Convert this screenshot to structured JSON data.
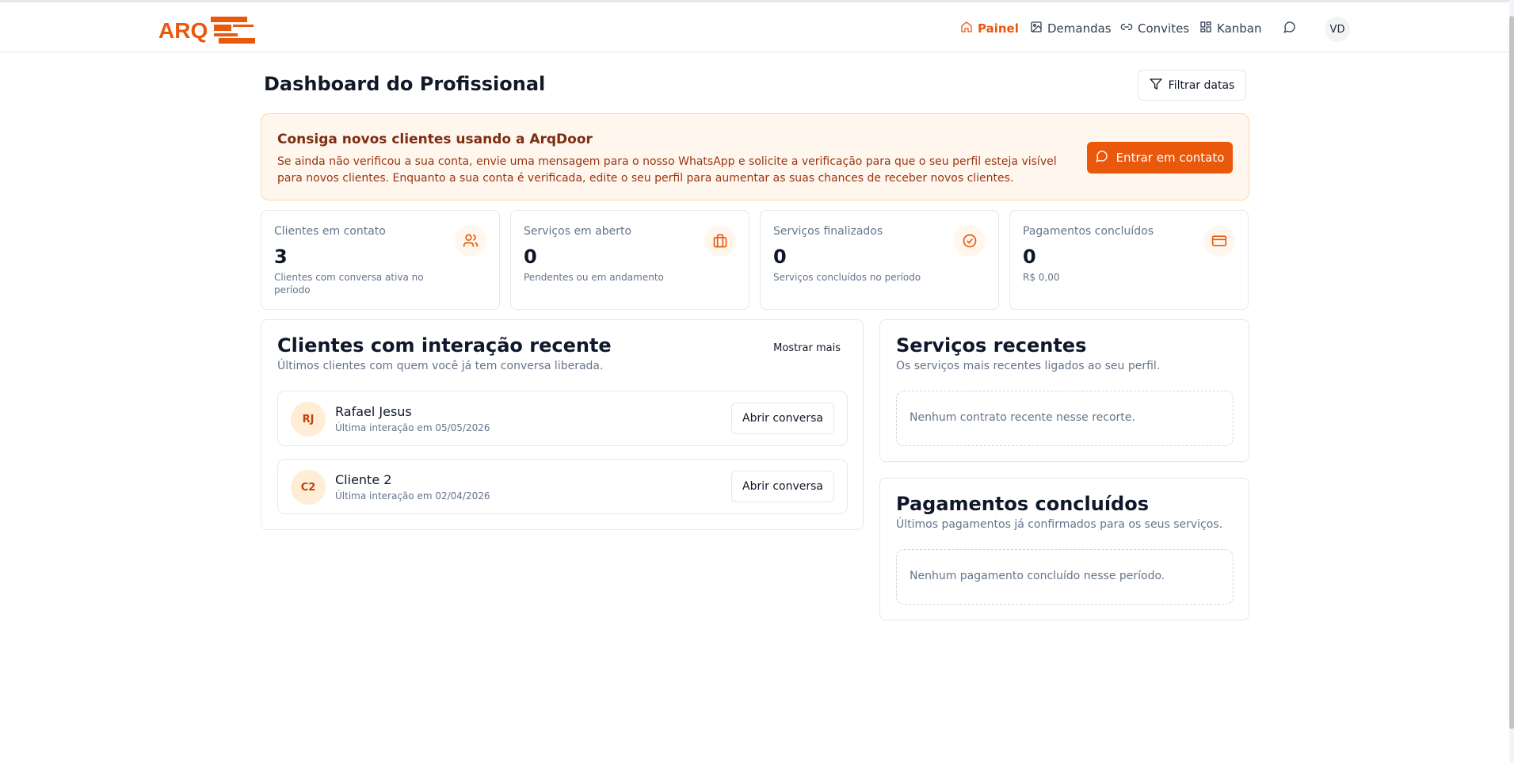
{
  "header": {
    "logo_text": "ARQ",
    "nav": [
      {
        "label": "Painel",
        "icon": "home-icon",
        "active": true
      },
      {
        "label": "Demandas",
        "icon": "image-icon",
        "active": false
      },
      {
        "label": "Convites",
        "icon": "link-icon",
        "active": false
      },
      {
        "label": "Kanban",
        "icon": "grid-icon",
        "active": false
      }
    ],
    "chat_icon": "chat-icon",
    "user_initials": "VD"
  },
  "page": {
    "title": "Dashboard do Profissional",
    "filter_label": "Filtrar datas"
  },
  "banner": {
    "title": "Consiga novos clientes usando a ArqDoor",
    "text": "Se ainda não verificou a sua conta, envie uma mensagem para o nosso WhatsApp e solicite a verificação para que o seu perfil esteja visível para novos clientes. Enquanto a sua conta é verificada, edite o seu perfil para aumentar as suas chances de receber novos clientes.",
    "button_label": "Entrar em contato"
  },
  "stats": [
    {
      "label": "Clientes em contato",
      "value": "3",
      "sub": "Clientes com conversa ativa no período",
      "icon": "users-icon"
    },
    {
      "label": "Serviços em aberto",
      "value": "0",
      "sub": "Pendentes ou em andamento",
      "icon": "briefcase-icon"
    },
    {
      "label": "Serviços finalizados",
      "value": "0",
      "sub": "Serviços concluídos no período",
      "icon": "check-circle-icon"
    },
    {
      "label": "Pagamentos concluídos",
      "value": "0",
      "sub": "R$ 0,00",
      "icon": "credit-card-icon"
    }
  ],
  "recent_clients": {
    "title": "Clientes com interação recente",
    "subtitle": "Últimos clientes com quem você já tem conversa liberada.",
    "more_label": "Mostrar mais",
    "items": [
      {
        "initials": "RJ",
        "name": "Rafael Jesus",
        "date": "Última interação em 05/05/2026",
        "button": "Abrir conversa"
      },
      {
        "initials": "C2",
        "name": "Cliente 2",
        "date": "Última interação em 02/04/2026",
        "button": "Abrir conversa"
      }
    ]
  },
  "recent_services": {
    "title": "Serviços recentes",
    "subtitle": "Os serviços mais recentes ligados ao seu perfil.",
    "empty": "Nenhum contrato recente nesse recorte."
  },
  "payments": {
    "title": "Pagamentos concluídos",
    "subtitle": "Últimos pagamentos já confirmados para os seus serviços.",
    "empty": "Nenhum pagamento concluído nesse período."
  },
  "colors": {
    "accent": "#ea580c",
    "banner_bg": "#fff7ed",
    "banner_border": "#fed7aa",
    "icon_bg": "#fff7ed"
  }
}
